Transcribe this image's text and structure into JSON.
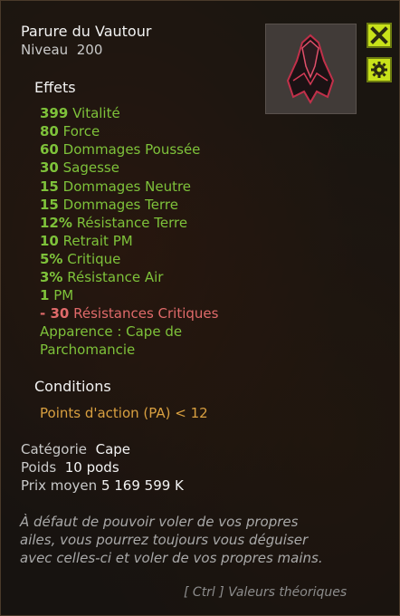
{
  "item": {
    "name": "Parure du Vautour",
    "level_label": "Niveau",
    "level_value": "200"
  },
  "buttons": {
    "close_icon": "close-x-icon",
    "settings_icon": "gear-icon"
  },
  "effects": {
    "title": "Effets",
    "rows": [
      {
        "value": "399",
        "label": "Vitalité"
      },
      {
        "value": "80",
        "label": "Force"
      },
      {
        "value": "60",
        "label": "Dommages Poussée"
      },
      {
        "value": "30",
        "label": "Sagesse"
      },
      {
        "value": "15",
        "label": "Dommages Neutre"
      },
      {
        "value": "15",
        "label": "Dommages Terre"
      },
      {
        "value": "12%",
        "label": "Résistance Terre"
      },
      {
        "value": "10",
        "label": "Retrait PM"
      },
      {
        "value": "5%",
        "label": "Critique"
      },
      {
        "value": "3%",
        "label": "Résistance Air"
      },
      {
        "value": "1",
        "label": "PM"
      },
      {
        "value": "- 30",
        "label": "Résistances Critiques"
      }
    ],
    "appearance_line1": "Apparence : Cape de",
    "appearance_line2": "Parchomancie"
  },
  "conditions": {
    "title": "Conditions",
    "text": "Points d'action (PA) < 12"
  },
  "info": {
    "category_label": "Catégorie",
    "category_value": "Cape",
    "weight_label": "Poids",
    "weight_value": "10 pods",
    "price_label": "Prix moyen",
    "price_value": "5 169 599 K"
  },
  "description": {
    "line1": "À défaut de pouvoir voler de vos propres",
    "line2": "ailes, vous pourrez toujours vous déguiser",
    "line3": "avec celles-ci et voler de vos propres mains."
  },
  "footer": {
    "hint": "[ Ctrl ] Valeurs théoriques"
  },
  "colors": {
    "effect_green": "#7ec23a",
    "negative_red": "#e06a6a",
    "condition_gold": "#d9a040",
    "button_yellow": "#c8e21a"
  }
}
